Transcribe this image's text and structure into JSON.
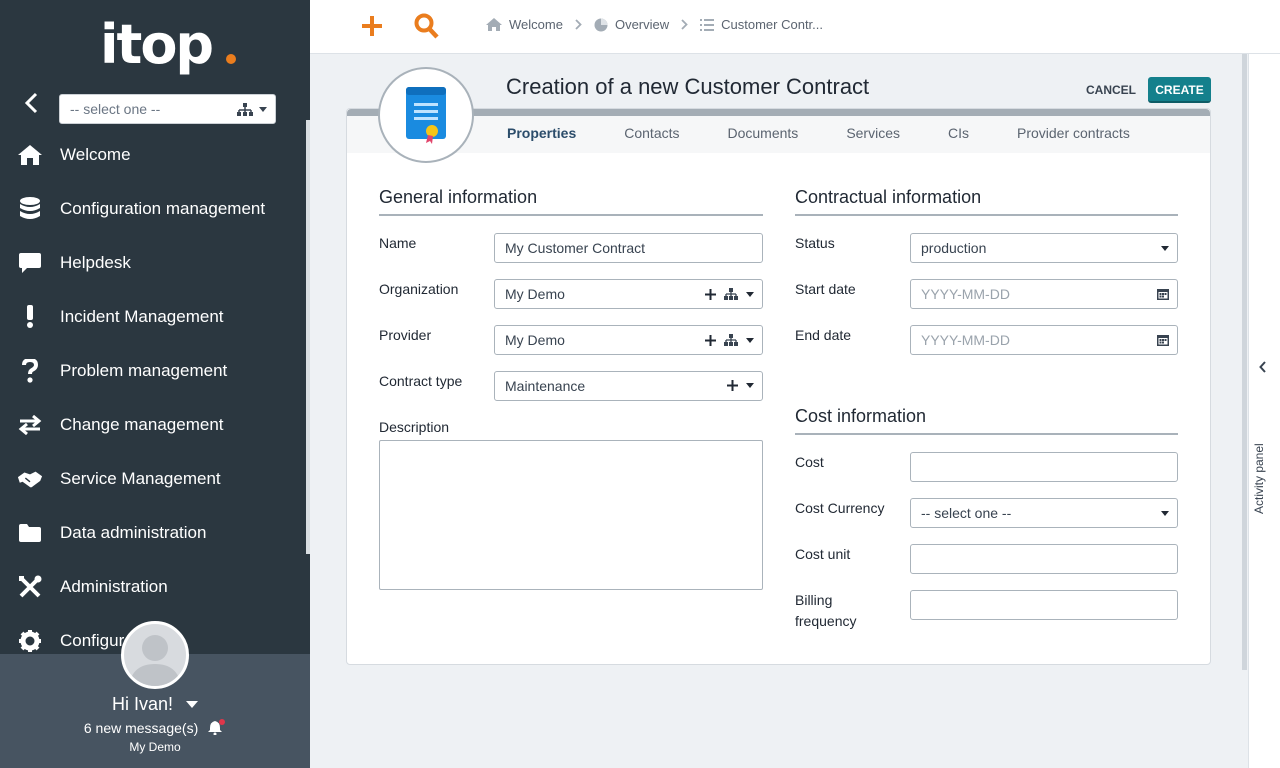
{
  "sidebar": {
    "logo_text": "itop",
    "org_select_placeholder": "-- select one --",
    "menu": [
      {
        "label": "Welcome",
        "icon": "house-icon"
      },
      {
        "label": "Configuration management",
        "icon": "database-icon"
      },
      {
        "label": "Helpdesk",
        "icon": "speech-bubble-icon"
      },
      {
        "label": "Incident Management",
        "icon": "exclamation-icon"
      },
      {
        "label": "Problem management",
        "icon": "question-icon"
      },
      {
        "label": "Change management",
        "icon": "arrows-exchange-icon"
      },
      {
        "label": "Service Management",
        "icon": "handshake-icon"
      },
      {
        "label": "Data administration",
        "icon": "folder-icon"
      },
      {
        "label": "Administration",
        "icon": "tools-icon"
      },
      {
        "label": "Configur",
        "icon": "gear-icon"
      }
    ],
    "user": {
      "greeting": "Hi Ivan!",
      "messages": "6 new message(s)",
      "organization": "My Demo"
    }
  },
  "topbar": {
    "breadcrumb": [
      "Welcome",
      "Overview",
      "Customer Contr..."
    ]
  },
  "page": {
    "title": "Creation of a new Customer Contract",
    "cancel_label": "CANCEL",
    "create_label": "CREATE",
    "tabs": [
      "Properties",
      "Contacts",
      "Documents",
      "Services",
      "CIs",
      "Provider contracts"
    ],
    "active_tab": "Properties"
  },
  "general": {
    "title": "General information",
    "name_label": "Name",
    "name_value": "My Customer Contract",
    "organization_label": "Organization",
    "organization_value": "My Demo",
    "provider_label": "Provider",
    "provider_value": "My Demo",
    "contract_type_label": "Contract type",
    "contract_type_value": "Maintenance",
    "description_label": "Description"
  },
  "contractual": {
    "title": "Contractual information",
    "status_label": "Status",
    "status_value": "production",
    "start_date_label": "Start date",
    "start_date_placeholder": "YYYY-MM-DD",
    "end_date_label": "End date",
    "end_date_placeholder": "YYYY-MM-DD"
  },
  "cost": {
    "title": "Cost information",
    "cost_label": "Cost",
    "currency_label": "Cost Currency",
    "currency_value": "-- select one --",
    "unit_label": "Cost unit",
    "billing_label_1": "Billing",
    "billing_label_2": "frequency"
  },
  "activity_panel": {
    "label": "Activity panel"
  },
  "colors": {
    "sidebar_bg": "#2b3740",
    "accent_orange": "#ea7d1e",
    "create_button": "#14808c",
    "notification_dot": "#e0364a"
  }
}
